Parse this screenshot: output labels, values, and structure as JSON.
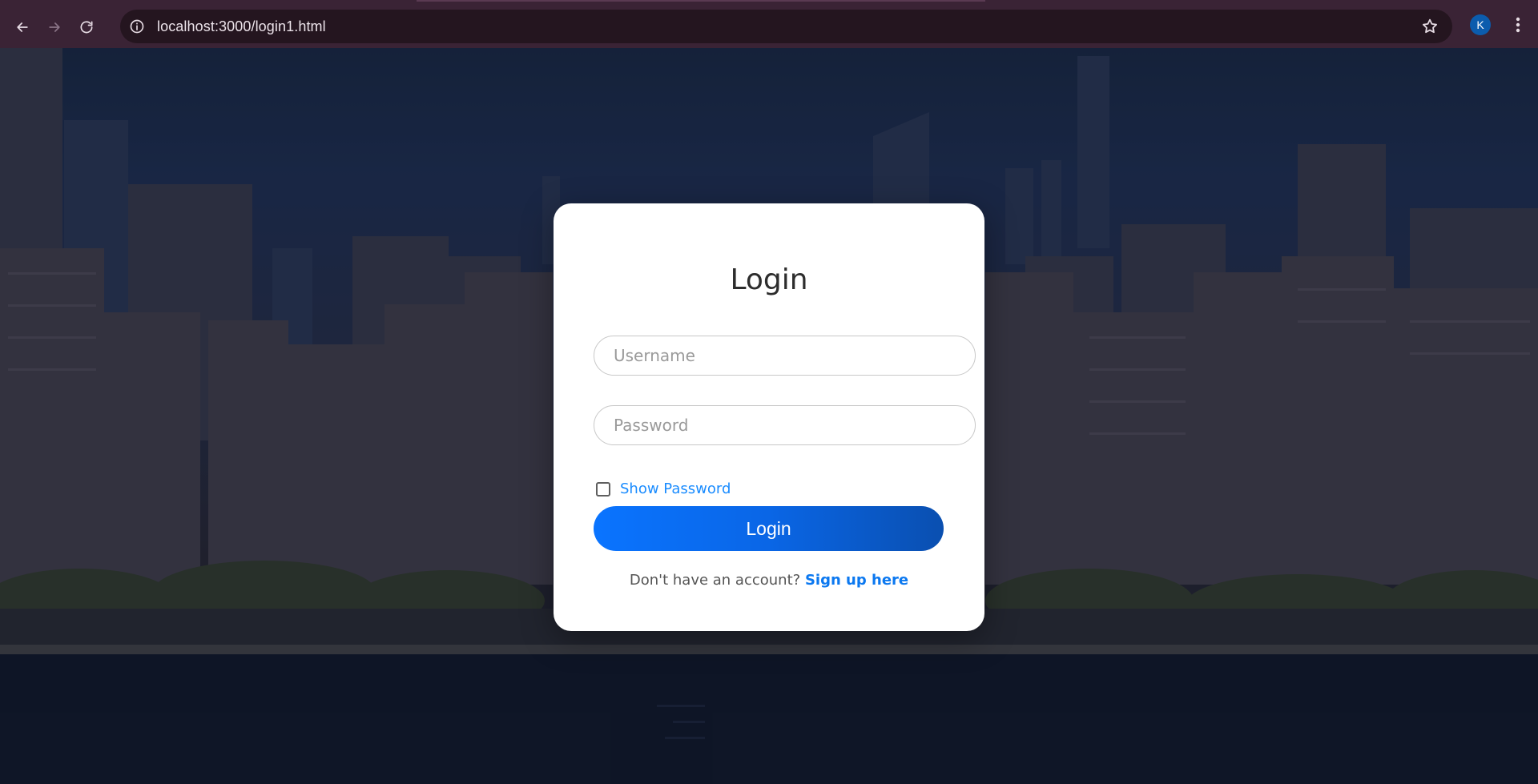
{
  "browser": {
    "url": "localhost:3000/login1.html",
    "profile_initial": "K",
    "icons": {
      "back": "arrow-left-icon",
      "forward": "arrow-right-icon",
      "reload": "reload-icon",
      "site_info": "info-icon",
      "bookmark": "star-icon",
      "menu": "kebab-menu-icon"
    }
  },
  "login": {
    "title": "Login",
    "username_placeholder": "Username",
    "password_placeholder": "Password",
    "show_password_label": "Show Password",
    "show_password_checked": false,
    "submit_label": "Login",
    "signup_prompt": "Don't have an account?",
    "signup_link": "Sign up here"
  },
  "colors": {
    "accent": "#0a74ff",
    "link": "#1a8cff",
    "card_bg": "#ffffff"
  }
}
